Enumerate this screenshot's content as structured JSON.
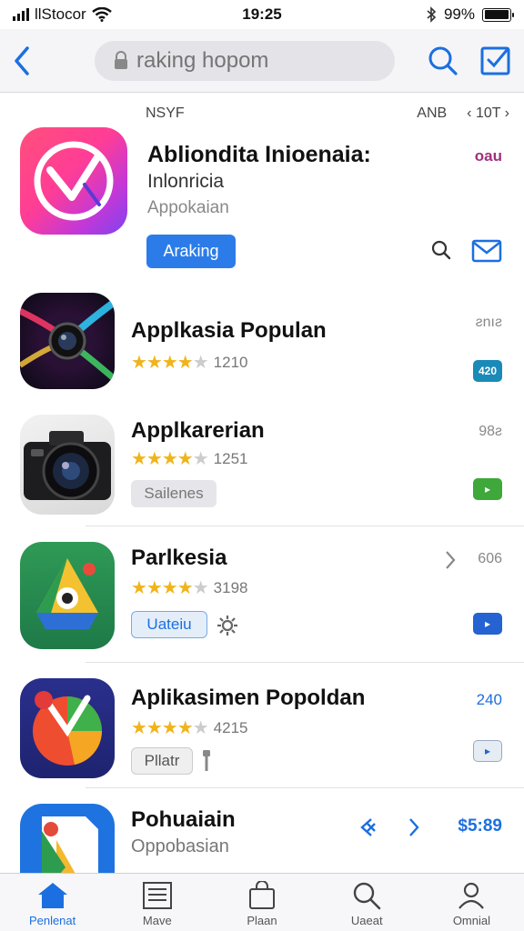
{
  "status_bar": {
    "carrier": "llStocor",
    "time": "19:25",
    "battery_percent": "99%",
    "battery_level": 0.99
  },
  "search": {
    "placeholder": "raking hopom"
  },
  "featured": {
    "header_left": "NSYF",
    "header_mid": "ANB",
    "header_right": "‹ 10T ›",
    "title": "Abliondita Inioenaia:",
    "subtitle": "Inlonricia",
    "category": "Appokaian",
    "price": "oau",
    "button_label": "Araking"
  },
  "apps": [
    {
      "name": "Applkasia Populan",
      "rating_count": "1210",
      "rating": 4,
      "meta": "ƨnıƨ",
      "badge": "420",
      "badge_color": "#1a8ab8"
    },
    {
      "name": "Applkarerian",
      "rating_count": "1251",
      "rating": 4,
      "meta": "98ƨ",
      "button_label": "Sailenes",
      "badge": "▸",
      "badge_color": "#3ea83a"
    },
    {
      "name": "Parlkesia",
      "rating_count": "3198",
      "rating": 4,
      "meta": "606",
      "button_label": "Uateiu",
      "badge": "▸",
      "badge_color": "#2463d1"
    },
    {
      "name": "Aplikasimen Popoldan",
      "rating_count": "4215",
      "rating": 4,
      "meta": "240",
      "button_label": "Pllatr",
      "badge": "▸",
      "badge_color": "#e6ecf3"
    },
    {
      "name": "Pohuaiain",
      "subtitle": "Oppobasian",
      "price": "$5:89"
    }
  ],
  "tabs": [
    {
      "label": "Penlenat",
      "icon": "home-icon"
    },
    {
      "label": "Mave",
      "icon": "list-icon"
    },
    {
      "label": "Plaan",
      "icon": "bag-icon"
    },
    {
      "label": "Uaeat",
      "icon": "search-icon"
    },
    {
      "label": "Omnial",
      "icon": "person-icon"
    }
  ],
  "colors": {
    "accent": "#1c6fe0",
    "featured_button": "#2b7ce9",
    "stars": "#f0b41b"
  }
}
